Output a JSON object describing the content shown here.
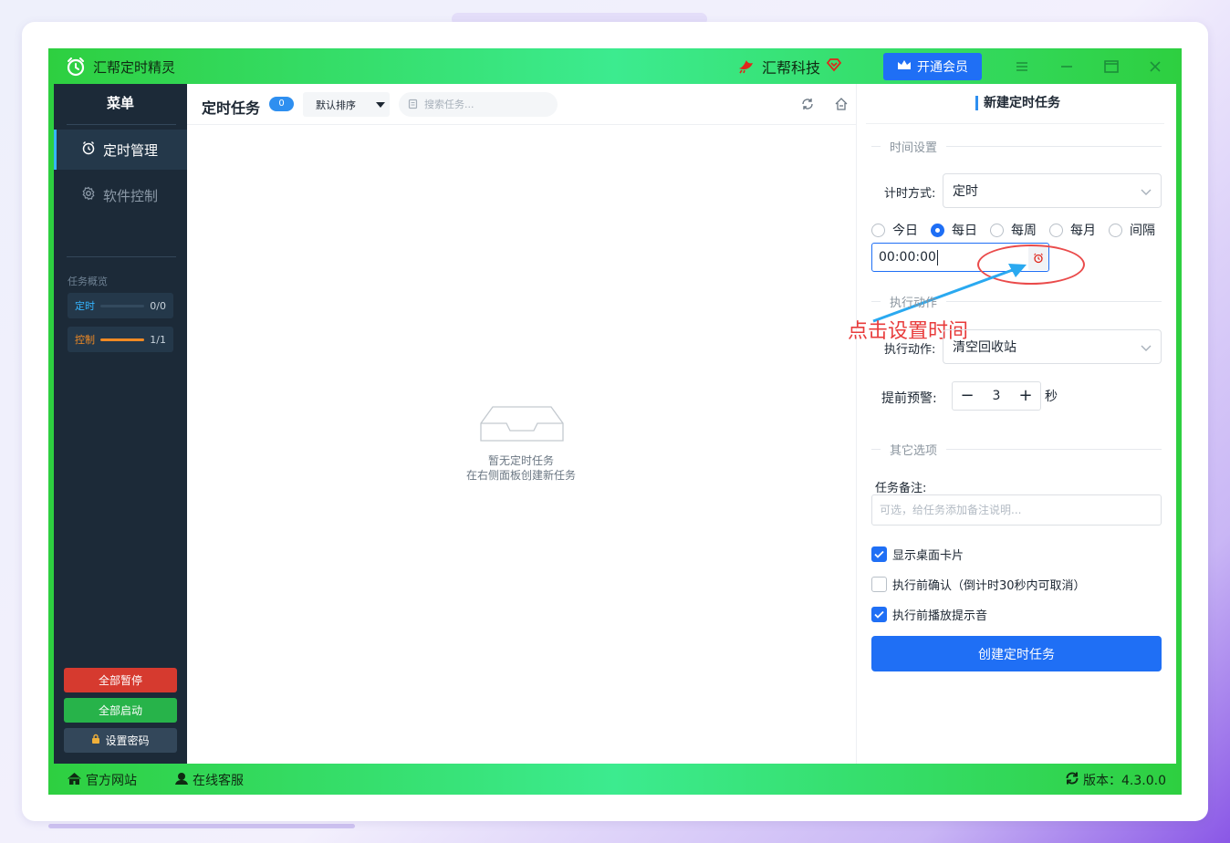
{
  "app": {
    "title": "汇帮定时精灵",
    "brand": "汇帮科技",
    "vip_label": "开通会员"
  },
  "sidebar": {
    "title": "菜单",
    "items": [
      {
        "label": "定时管理",
        "icon": "alarm-clock-icon",
        "active": true
      },
      {
        "label": "软件控制",
        "icon": "gear-icon",
        "active": false
      }
    ],
    "overview_label": "任务概览",
    "overview": [
      {
        "label": "定时",
        "count": "0/0",
        "progress": 0,
        "color": "#35b5ff"
      },
      {
        "label": "控制",
        "count": "1/1",
        "progress": 1,
        "color": "#f08a24"
      }
    ],
    "buttons": {
      "pause_all": "全部暂停",
      "start_all": "全部启动",
      "set_password": "设置密码"
    }
  },
  "main": {
    "title": "定时任务",
    "count": "0",
    "sort_label": "默认排序",
    "search_placeholder": "搜索任务...",
    "empty_line1": "暂无定时任务",
    "empty_line2": "在右侧面板创建新任务"
  },
  "panel": {
    "title": "新建定时任务",
    "section_time": "时间设置",
    "timing_label": "计时方式:",
    "timing_value": "定时",
    "radios": [
      {
        "label": "今日",
        "checked": false
      },
      {
        "label": "每日",
        "checked": true
      },
      {
        "label": "每周",
        "checked": false
      },
      {
        "label": "每月",
        "checked": false
      },
      {
        "label": "间隔",
        "checked": false
      }
    ],
    "time_value": "00:00:00",
    "section_action": "执行动作",
    "action_label": "执行动作:",
    "action_value": "清空回收站",
    "warn_label": "提前预警:",
    "warn_value": "3",
    "warn_unit": "秒",
    "section_other": "其它选项",
    "note_label": "任务备注:",
    "note_placeholder": "可选，给任务添加备注说明...",
    "checks": [
      {
        "label": "显示桌面卡片",
        "checked": true
      },
      {
        "label": "执行前确认（倒计时30秒内可取消）",
        "checked": false
      },
      {
        "label": "执行前播放提示音",
        "checked": true
      }
    ],
    "create_label": "创建定时任务",
    "annotation": "点击设置时间"
  },
  "footer": {
    "website": "官方网站",
    "support": "在线客服",
    "version": "版本：4.3.0.0"
  },
  "colors": {
    "accent": "#1f6ff5",
    "sidebar_bg": "#1c2a38",
    "title_green": "#3ceb8f",
    "danger": "#d63a2f",
    "success": "#27b34a"
  }
}
